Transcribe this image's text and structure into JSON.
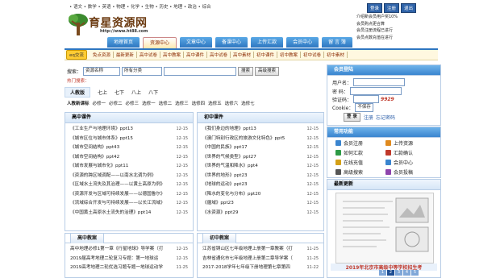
{
  "top_subjects": "• 语文 • 数学 • 英语 • 物理 • 化学 • 生物 • 历史 • 地理 • 政治 • 综合",
  "logo": {
    "text": "育星资源网",
    "url": "http://www.ht88.com"
  },
  "top_buttons": [
    "登录",
    "注册",
    "退出"
  ],
  "top_news": [
    "介绍新会员用户奖10%",
    "会员购点更合算",
    "会员注册流程已进行",
    "会员点数充值在进行"
  ],
  "nav": {
    "tabs": [
      "地理首页",
      "资源中心",
      "文章中心",
      "备课中心",
      "上传汇款",
      "会员中心",
      "留 言 簿"
    ],
    "active_index": 1
  },
  "subnav": {
    "eye_label": "eq交流",
    "items": [
      "免点资源",
      "最新更新",
      "高中试卷",
      "高中教案",
      "高中课件",
      "高中试卷",
      "高中素材",
      "初中课件",
      "初中教案",
      "初中试卷",
      "初中素材"
    ]
  },
  "search": {
    "label": "搜索：",
    "field_select": "资源名称",
    "category_select": "所有分类",
    "query": "",
    "button": "搜索",
    "advanced_button": "高级搜索"
  },
  "hot_label": "热门搜索：",
  "grades": {
    "edition": "人教版",
    "grades": [
      "七上",
      "七下",
      "八上",
      "八下"
    ],
    "row2": [
      "人教新课标",
      "必修一",
      "必修二",
      "必修三",
      "选修一",
      "选修二",
      "选修三",
      "选修四",
      "选修五",
      "选修六",
      "选修七"
    ]
  },
  "gaozhong": {
    "title": "高中课件",
    "items": [
      {
        "t": "《工业生产与地理环境》ppt13",
        "d": "12-15"
      },
      {
        "t": "《城市区位与城市体系》ppt15",
        "d": "12-15"
      },
      {
        "t": "《城市空间结构》ppt43",
        "d": "12-15"
      },
      {
        "t": "《城市空间结构》ppt42",
        "d": "12-15"
      },
      {
        "t": "《城市发展与城市化》ppt11",
        "d": "12-15"
      },
      {
        "t": "《资源的跨区域调配——以南水北调为例》",
        "d": "12-15"
      },
      {
        "t": "《区域水土流失及其治理——以黄土高原为例》",
        "d": "12-15"
      },
      {
        "t": "《资源开发与区域可持续发展——以德国鲁尔》",
        "d": "12-15"
      },
      {
        "t": "《流域综合开发与可持续发展——以长江流域》",
        "d": "12-15"
      },
      {
        "t": "《中国黄土高原水土流失的治理》ppt14",
        "d": "12-15"
      }
    ]
  },
  "chuzhong": {
    "title": "初中课件",
    "items": [
      {
        "t": "《我们身边的地理》ppt13",
        "d": "12-15"
      },
      {
        "t": "《澳门特别行政区的旅游文化特色》ppt5",
        "d": "12-15"
      },
      {
        "t": "《中国的民族》ppt17",
        "d": "12-15"
      },
      {
        "t": "《世界的气候类型》ppt27",
        "d": "12-15"
      },
      {
        "t": "《世界的气温和降水》ppt4",
        "d": "12-15"
      },
      {
        "t": "《世界的地形》ppt23",
        "d": "12-15"
      },
      {
        "t": "《地球的运动》ppt23",
        "d": "12-15"
      },
      {
        "t": "《降水的变化与分布》ppt20",
        "d": "12-15"
      },
      {
        "t": "《疆域》ppt23",
        "d": "12-15"
      },
      {
        "t": "《水资源》ppt29",
        "d": "12-15"
      }
    ]
  },
  "gaozhong2": {
    "title": "高中教案",
    "items": [
      {
        "t": "高中地理必修1第一章《行星地球》导学案（打",
        "d": "12-15"
      },
      {
        "t": "2019届高考地理二轮复习专题：第一地球运",
        "d": "12-15"
      },
      {
        "t": "2019高考地理二轮优选习题专题一地球运动学",
        "d": "11-25"
      }
    ]
  },
  "chuzhong2": {
    "title": "初中教案",
    "items": [
      {
        "t": "江苏省铜山区七年级地理上册第一章教案（打",
        "d": "11-25"
      },
      {
        "t": "吉林省通化市七年级地理上册第二章导学案（",
        "d": "11-25"
      },
      {
        "t": "2017-2018学年七年级下册地理第七章第四",
        "d": "11-22"
      }
    ]
  },
  "login": {
    "title": "会员登陆",
    "username_label": "用户名：",
    "password_label": "密  码：",
    "captcha_label": "验证码：",
    "captcha_value": "9929",
    "cookie_label": "Cookie：",
    "cookie_option": "不保存",
    "login_button": "登 录",
    "register_link": "注册",
    "forgot_link": "忘记密码"
  },
  "func": {
    "title": "常用功能",
    "items": [
      "会员注册",
      "上传资源",
      "如何汇款",
      "汇款确认",
      "在线充值",
      "会员中心",
      "高级搜索",
      "会员投稿"
    ]
  },
  "latest": {
    "title": "最新更新",
    "caption": "2019年北京市高级中等学校招生考",
    "pages": [
      "1",
      "2",
      "3",
      "4",
      "5"
    ],
    "active_page": 1
  },
  "colors": {
    "accent": "#2e76c0",
    "brand": "#6b3a10",
    "highlight": "#c0392b"
  }
}
